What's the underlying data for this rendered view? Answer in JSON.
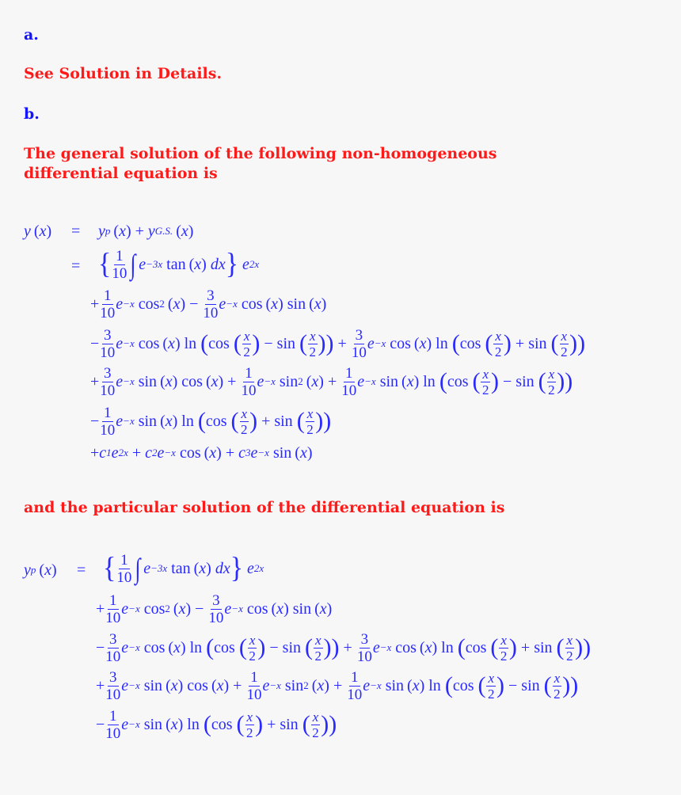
{
  "part_a": {
    "label": "a.",
    "text": "See Solution in Details."
  },
  "part_b": {
    "label": "b.",
    "general_intro": "The general solution of the following non-homogeneous differential equation is",
    "particular_intro": "and the particular solution of the differential equation is"
  },
  "general_solution": {
    "lhs": "y (x)",
    "eq": "=",
    "line1": "yp(x) + yG.S.(x)",
    "integral_term": "{ (1/10) ∫ e^(−3x) tan(x) dx } e^(2x)",
    "term_lines": [
      "+ (1/10) e^(−x) cos²(x) − (3/10) e^(−x) cos(x) sin(x)",
      "− (3/10) e^(−x) cos(x) ln(cos(x/2) − sin(x/2)) + (3/10) e^(−x) cos(x) ln(cos(x/2) + sin(x/2))",
      "+ (3/10) e^(−x) sin(x) cos(x) + (1/10) e^(−x) sin²(x) + (1/10) e^(−x) sin(x) ln(cos(x/2) − sin(x/2))",
      "− (1/10) e^(−x) sin(x) ln(cos(x/2) + sin(x/2))",
      "+ c1 e^(2x) + c2 e^(−x) cos(x) + c3 e^(−x) sin(x)"
    ]
  },
  "particular_solution": {
    "lhs": "yp (x)",
    "eq": "="
  }
}
